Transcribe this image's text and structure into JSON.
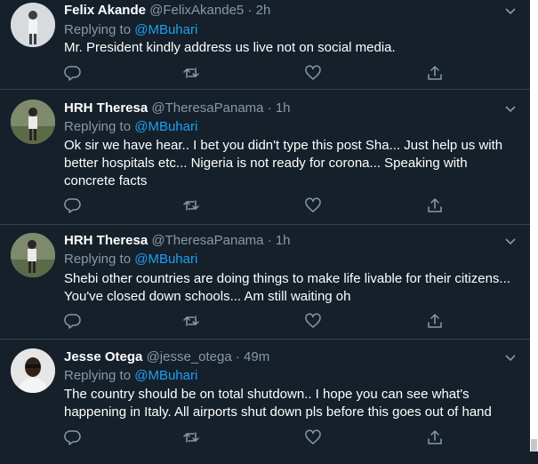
{
  "tweets": [
    {
      "name": "Felix Akande",
      "handle": "@FelixAkande5",
      "dot": "·",
      "time": "2h",
      "replying_prefix": "Replying to",
      "replying_to": "@MBuhari",
      "text": "Mr. President kindly address us live not on social media."
    },
    {
      "name": "HRH Theresa",
      "handle": "@TheresaPanama",
      "dot": "·",
      "time": "1h",
      "replying_prefix": "Replying to",
      "replying_to": "@MBuhari",
      "text": "Ok sir we have hear.. I bet you didn't type this post Sha... Just help us with better hospitals etc... Nigeria is not ready for corona... Speaking with concrete facts"
    },
    {
      "name": "HRH Theresa",
      "handle": "@TheresaPanama",
      "dot": "·",
      "time": "1h",
      "replying_prefix": "Replying to",
      "replying_to": "@MBuhari",
      "text": "Shebi other countries are doing things to make life livable for their citizens... You've closed down schools... Am still waiting oh"
    },
    {
      "name": "Jesse Otega",
      "handle": "@jesse_otega",
      "dot": "·",
      "time": "49m",
      "replying_prefix": "Replying to",
      "replying_to": "@MBuhari",
      "text": "The country should be on total shutdown.. I hope you can see what's happening in Italy. All airports shut down pls before this goes out of hand"
    }
  ],
  "icons": {
    "more": "chevron-down-icon",
    "reply": "reply-icon",
    "retweet": "retweet-icon",
    "like": "like-icon",
    "share": "share-icon"
  },
  "colors": {
    "background": "#15202b",
    "secondary_text": "#8899a6",
    "accent": "#1da1f2",
    "divider": "#38444d"
  }
}
